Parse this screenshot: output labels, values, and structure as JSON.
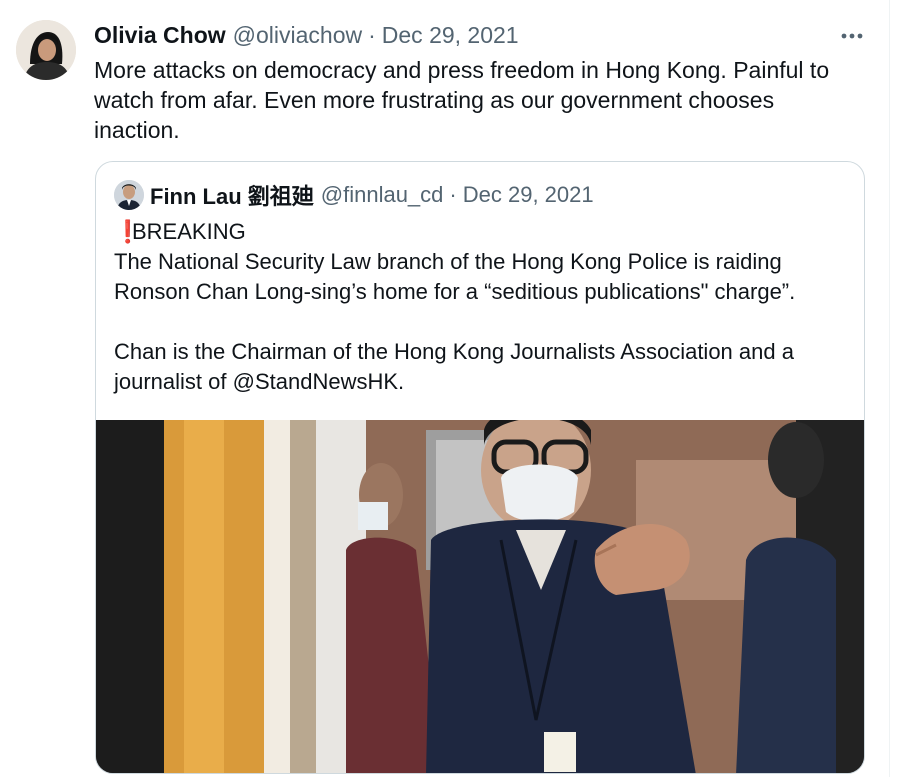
{
  "tweet": {
    "author_name": "Olivia Chow",
    "author_handle": "@oliviachow",
    "separator": "·",
    "date": "Dec 29, 2021",
    "more_label": "•••",
    "text": "More attacks on democracy and press freedom in Hong Kong. Painful to watch from afar. Even more frustrating as our government chooses inaction."
  },
  "quote": {
    "author_name": "Finn Lau 劉祖廸",
    "author_handle": "@finnlau_cd",
    "separator": "·",
    "date": "Dec 29, 2021",
    "emoji": "❗",
    "line1": "BREAKING",
    "line2": "The National Security Law branch of the Hong Kong Police is raiding Ronson Chan Long-sing’s home for a “seditious publications\" charge”.",
    "line3": "Chan is the Chairman of the Hong Kong Journalists Association and a journalist of @StandNewsHK."
  },
  "colors": {
    "text_primary": "#0f1419",
    "text_secondary": "#536471",
    "border": "#cfd9de",
    "alert_red": "#dd2e44"
  },
  "icons": {
    "more": "more-horizontal-icon",
    "alert": "exclamation-icon"
  }
}
